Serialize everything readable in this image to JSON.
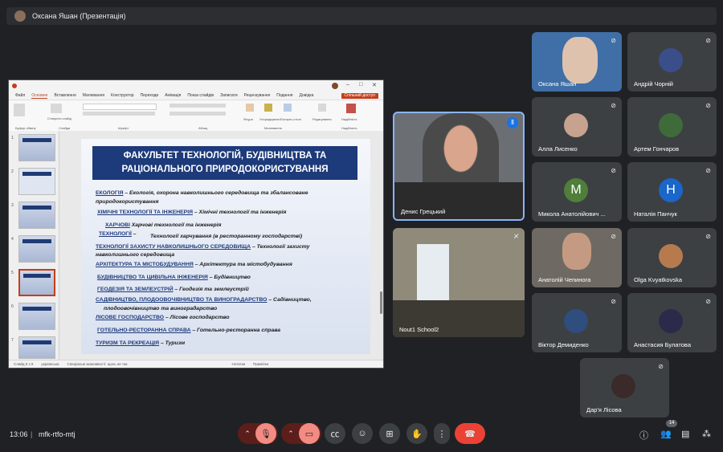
{
  "presenter_bar": {
    "label": "Оксана Яшан (Презентація)"
  },
  "ppt": {
    "menu": [
      "Файл",
      "Основне",
      "Вставлення",
      "Малювання",
      "Конструктор",
      "Переходи",
      "Анімація",
      "Показ слайдів",
      "Записати",
      "Рецензування",
      "Подання",
      "Довідка"
    ],
    "share": "Спільний доступ",
    "groups": [
      "Буфер обміну",
      "Слайди",
      "Шрифт",
      "Абзац",
      "Малювання",
      "Надійність"
    ],
    "ribbon_labels": {
      "create_slide": "Створити слайд",
      "shapes": "Фігури",
      "arrange": "Упорядкувати",
      "quick_styles": "Експрес-стилі",
      "edit": "Редагування",
      "sensitivity": "Надійність"
    },
    "slide_numbers": [
      "1",
      "2",
      "3",
      "4",
      "5",
      "6",
      "7"
    ],
    "status": {
      "slide": "Слайд 5 з 9",
      "lang": "українська",
      "access": "Спеціальні можливості: щось не так",
      "notes": "Нотатки",
      "comments": "Примітки"
    },
    "slide": {
      "title": "ФАКУЛЬТЕТ ТЕХНОЛОГІЙ, БУДІВНИЦТВА ТА РАЦІОНАЛЬНОГО ПРИРОДОКОРИСТУВАННЯ",
      "items": [
        {
          "head": "ЕКОЛОГІЯ",
          "text": " – Екологія, охорона навколишнього середовища та збалансоване"
        },
        {
          "head": "",
          "text": "природокористування"
        },
        {
          "head": "ХІМІЧНІ ТЕХНОЛОГІЇ ТА ІНЖЕНЕРІЯ",
          "text": "  – Хімічні технології та інженерія"
        },
        {
          "head": "ХАРЧОВІ",
          "text": "           Харчові технології та інженерія"
        },
        {
          "head": "ТЕХНОЛОГІЇ",
          "text": " –"
        },
        {
          "head": "",
          "text": "Технології харчування  (в ресторанному господарстві)"
        },
        {
          "head": "ТЕХНОЛОГІЇ ЗАХИСТУ НАВКОЛИШНЬОГО СЕРЕДОВИЩА",
          "text": " – Технології захисту"
        },
        {
          "head": "",
          "text": "навколишнього середовища"
        },
        {
          "head": "АРХІТЕКТУРА  ТА МІСТОБУДУВАННЯ",
          "text": " – Архітектура та містобудування"
        },
        {
          "head": "БУДІВНИЦТВО ТА ЦИВІЛЬНА ІНЖЕНЕРІЯ",
          "text": " – Будівництво"
        },
        {
          "head": "ГЕОДЕЗІЯ ТА ЗЕМЛЕУСТРІЙ",
          "text": " – Геодезія та землеустрій"
        },
        {
          "head": "САДІВНИЦТВО, ПЛОДООВОЧІВНИЦТВО ТА ВИНОГРАДАРСТВО",
          "text": " – Садівництво,"
        },
        {
          "head": "",
          "text": "плодоовочівництво та виноградарство"
        },
        {
          "head": "ЛІСОВЕ ГОСПОДАРСТВО",
          "text": " – Лісове господарство"
        },
        {
          "head": "ГОТЕЛЬНО-РЕСТОРАННА СПРАВА",
          "text": " – Готельно-ресторанна справа"
        },
        {
          "head": "ТУРИЗМ ТА РЕКРЕАЦІЯ",
          "text": " – Туризм"
        }
      ]
    }
  },
  "participants": {
    "big1": "Денис Грецький",
    "big2": "Nout1 School2",
    "grid": [
      {
        "name": "Оксана Яшан"
      },
      {
        "name": "Андрій Чорній"
      },
      {
        "name": "Алла Лисенко"
      },
      {
        "name": "Артем Гончаров"
      },
      {
        "name": "Микола Анатолійович ...",
        "letter": "M",
        "color": "#4f7f3a"
      },
      {
        "name": "Наталія Панчук",
        "letter": "Н",
        "color": "#1a66c9"
      },
      {
        "name": "Анатолій Чепинога"
      },
      {
        "name": "Olga Kvyatkovska"
      },
      {
        "name": "Віктор Демиденко"
      },
      {
        "name": "Анастасия Булатова"
      },
      {
        "name": "Дар'я Лісова"
      }
    ]
  },
  "bottom": {
    "time": "13:06",
    "meeting_code": "mfk-rtfo-mtj",
    "people_count": "14"
  }
}
